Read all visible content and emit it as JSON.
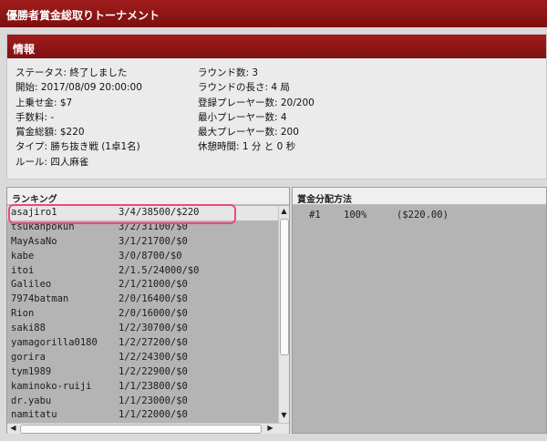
{
  "window": {
    "title": "優勝者賞金総取りトーナメント"
  },
  "info": {
    "header": "情報",
    "left": [
      "ステータス: 終了しました",
      "開始: 2017/08/09 20:00:00",
      "上乗せ金: $7",
      "手数料: -",
      "賞金総額: $220",
      "タイプ: 勝ち抜き戦 (1卓1名)",
      "ルール: 四人麻雀"
    ],
    "right": [
      "ラウンド数: 3",
      "ラウンドの長さ: 4 局",
      "登録プレーヤー数: 20/200",
      "最小プレーヤー数: 4",
      "最大プレーヤー数: 200",
      "休憩時間: 1 分 と 0 秒"
    ]
  },
  "ranking": {
    "header": "ランキング",
    "rows": [
      {
        "name": "asajiro1",
        "score": "3/4/38500/$220"
      },
      {
        "name": "tsukanpokun",
        "score": "3/2/31100/$0"
      },
      {
        "name": "MayAsaNo",
        "score": "3/1/21700/$0"
      },
      {
        "name": "kabe",
        "score": "3/0/8700/$0"
      },
      {
        "name": "itoi",
        "score": "2/1.5/24000/$0"
      },
      {
        "name": "Galileo",
        "score": "2/1/21000/$0"
      },
      {
        "name": "7974batman",
        "score": "2/0/16400/$0"
      },
      {
        "name": "Rion",
        "score": "2/0/16000/$0"
      },
      {
        "name": "saki88",
        "score": "1/2/30700/$0"
      },
      {
        "name": "yamagorilla0180",
        "score": "1/2/27200/$0"
      },
      {
        "name": "gorira",
        "score": "1/2/24300/$0"
      },
      {
        "name": "tym1989",
        "score": "1/2/22900/$0"
      },
      {
        "name": "kaminoko-ruiji",
        "score": "1/1/23800/$0"
      },
      {
        "name": "dr.yabu",
        "score": "1/1/23000/$0"
      },
      {
        "name": "namitatu",
        "score": "1/1/22000/$0"
      }
    ]
  },
  "prize": {
    "header": "賞金分配方法",
    "rows": [
      {
        "rank": "#1",
        "percent": "100%",
        "amount": "($220.00)"
      }
    ]
  },
  "scroll": {
    "up": "▲",
    "down": "▼",
    "left": "◀",
    "right": "▶"
  },
  "colors": {
    "titlebar": "#8f1616",
    "highlight": "#e84a7c",
    "panel": "#b4b4b4"
  }
}
